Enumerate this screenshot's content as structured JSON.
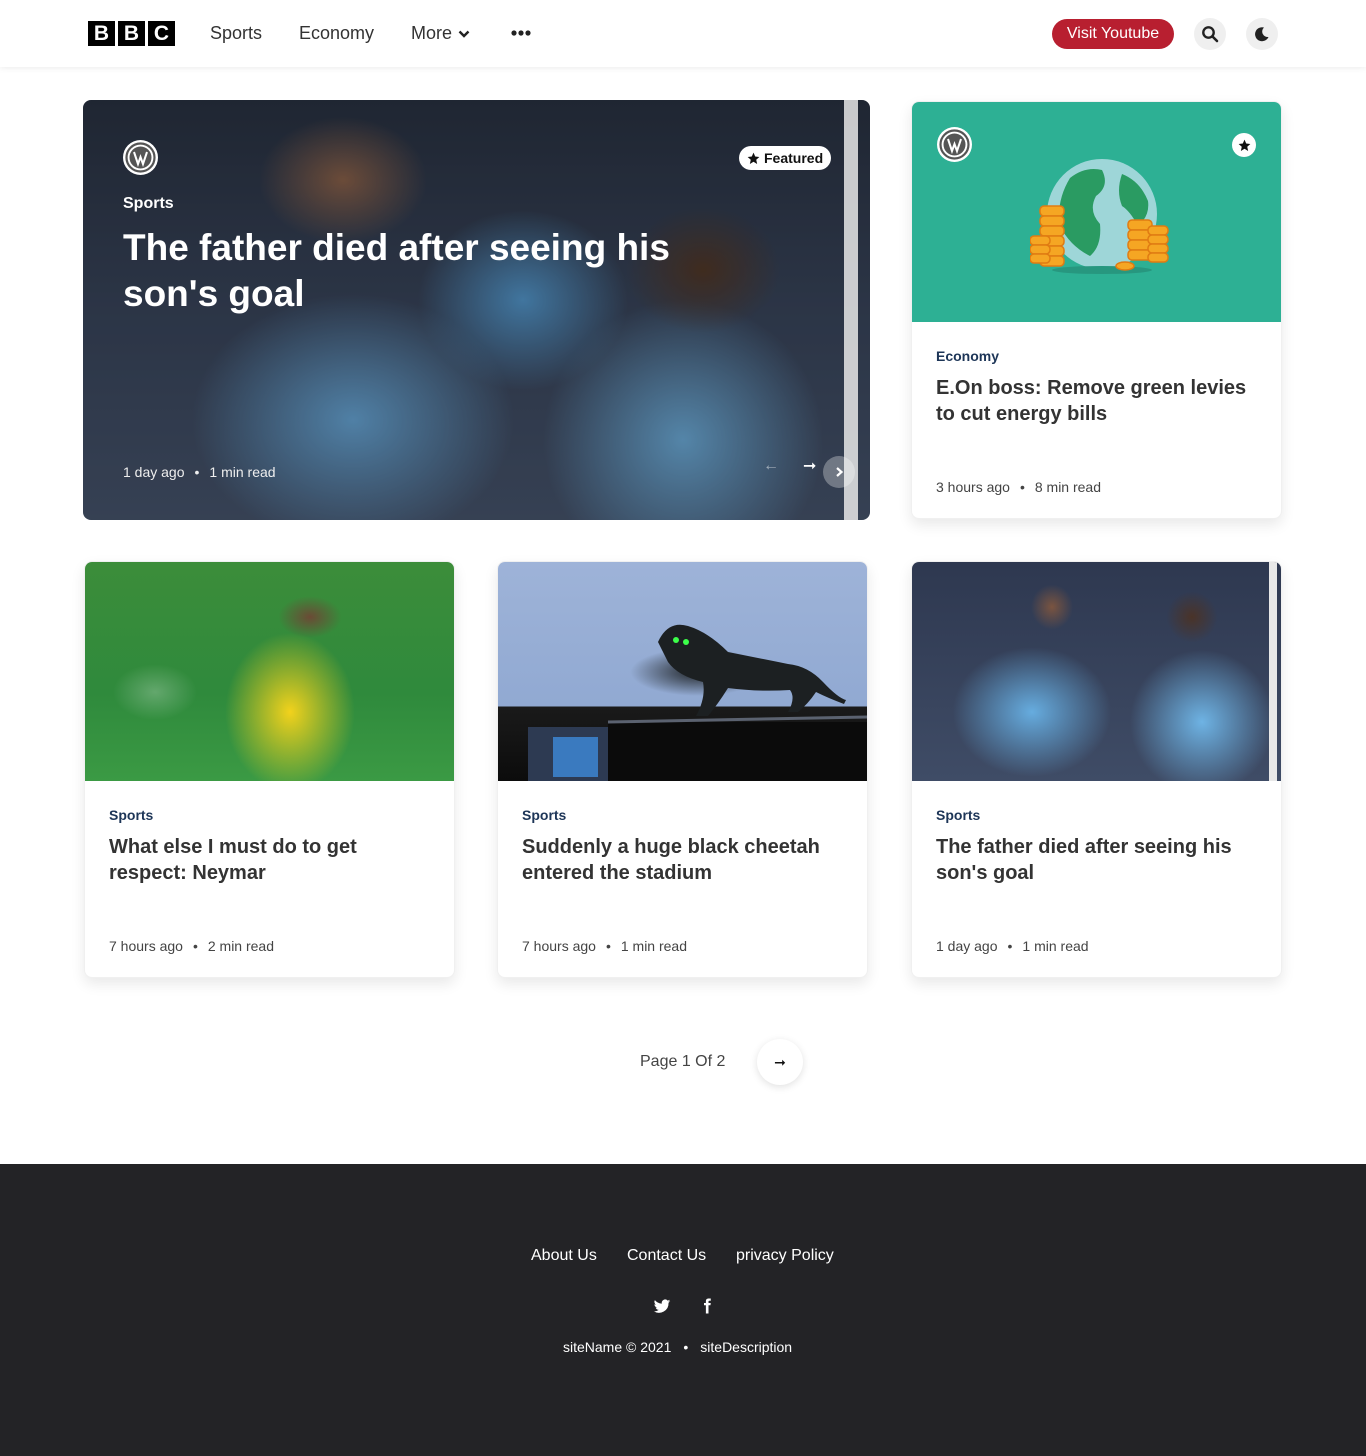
{
  "header": {
    "logo_letters": [
      "B",
      "B",
      "C"
    ],
    "nav": {
      "sports": "Sports",
      "economy": "Economy",
      "more": "More"
    },
    "visit_youtube": "Visit Youtube"
  },
  "hero": {
    "badge": "Featured",
    "category": "Sports",
    "title": "The father died after seeing his son's goal",
    "time": "1 day ago",
    "separator": "•",
    "read": "1 min read",
    "prev_arrow": "←",
    "next_arrow": "➞"
  },
  "cards": [
    {
      "category": "Economy",
      "title": "E.On boss: Remove green levies to cut energy bills",
      "time": "3 hours ago",
      "read": "8 min read"
    },
    {
      "category": "Sports",
      "title": "What else I must do to get respect: Neymar",
      "time": "7 hours ago",
      "read": "2 min read"
    },
    {
      "category": "Sports",
      "title": "Suddenly a huge black cheetah entered the stadium",
      "time": "7 hours ago",
      "read": "1 min read"
    },
    {
      "category": "Sports",
      "title": "The father died after seeing his son's goal",
      "time": "1 day ago",
      "read": "1 min read"
    }
  ],
  "pagination": {
    "label": "Page 1 Of 2",
    "next": "➞"
  },
  "footer": {
    "links": [
      "About Us",
      "Contact Us",
      "privacy Policy"
    ],
    "copyright": "siteName © 2021",
    "separator": "•",
    "description": "siteDescription"
  },
  "colors": {
    "youtube": "#b81f30",
    "economy_bg": "#2db094",
    "footer_bg": "#232326",
    "category": "#1d3557"
  },
  "icons": [
    "chevron-down-icon",
    "more-dots-icon",
    "search-icon",
    "moon-icon",
    "wordpress-icon",
    "star-icon",
    "twitter-icon",
    "facebook-icon"
  ]
}
